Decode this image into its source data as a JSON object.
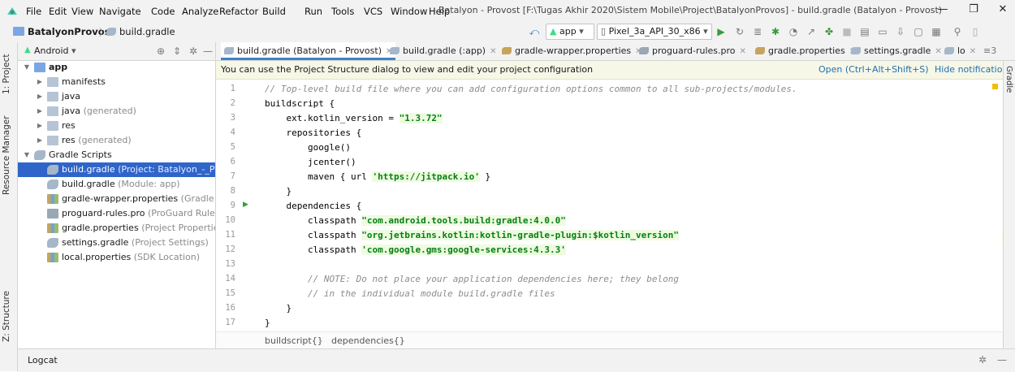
{
  "window": {
    "title": "Batalyon - Provost [F:\\Tugas Akhir 2020\\Sistem Mobile\\Project\\BatalyonProvos] - build.gradle (Batalyon - Provost)",
    "menu": [
      "File",
      "Edit",
      "View",
      "Navigate",
      "Code",
      "Analyze",
      "Refactor",
      "Build",
      "Run",
      "Tools",
      "VCS",
      "Window",
      "Help"
    ],
    "controls": {
      "minimize": "—",
      "maximize": "❐",
      "close": "✕"
    }
  },
  "navbar": {
    "project": "BatalyonProvos",
    "file": "build.gradle",
    "run_config": "app",
    "device": "Pixel_3a_API_30_x86"
  },
  "tool_stripe": {
    "project": "1: Project",
    "resource_manager": "Resource Manager",
    "structure": "Z: Structure"
  },
  "project_panel": {
    "view_mode": "Android",
    "tree": [
      {
        "label": "app",
        "hint": "",
        "level": 0,
        "arrow": "▼",
        "icon": "folder-blue",
        "bold": true
      },
      {
        "label": "manifests",
        "hint": "",
        "level": 1,
        "arrow": "▶",
        "icon": "folder"
      },
      {
        "label": "java",
        "hint": "",
        "level": 1,
        "arrow": "▶",
        "icon": "folder"
      },
      {
        "label": "java",
        "hint": "(generated)",
        "level": 1,
        "arrow": "▶",
        "icon": "folder"
      },
      {
        "label": "res",
        "hint": "",
        "level": 1,
        "arrow": "▶",
        "icon": "folder"
      },
      {
        "label": "res",
        "hint": "(generated)",
        "level": 1,
        "arrow": "▶",
        "icon": "folder"
      },
      {
        "label": "Gradle Scripts",
        "hint": "",
        "level": 0,
        "arrow": "▼",
        "icon": "gradle-ico"
      },
      {
        "label": "build.gradle",
        "hint": "(Project: Batalyon_-_Provo",
        "level": 1,
        "arrow": "",
        "icon": "gradle-ico",
        "selected": true
      },
      {
        "label": "build.gradle",
        "hint": "(Module: app)",
        "level": 1,
        "arrow": "",
        "icon": "gradle-ico"
      },
      {
        "label": "gradle-wrapper.properties",
        "hint": "(Gradle Vers",
        "level": 1,
        "arrow": "",
        "icon": "props-ico"
      },
      {
        "label": "proguard-rules.pro",
        "hint": "(ProGuard Rules fo",
        "level": 1,
        "arrow": "",
        "icon": "doc-ico"
      },
      {
        "label": "gradle.properties",
        "hint": "(Project Properties)",
        "level": 1,
        "arrow": "",
        "icon": "props-ico"
      },
      {
        "label": "settings.gradle",
        "hint": "(Project Settings)",
        "level": 1,
        "arrow": "",
        "icon": "gradle-ico"
      },
      {
        "label": "local.properties",
        "hint": "(SDK Location)",
        "level": 1,
        "arrow": "",
        "icon": "props-ico"
      }
    ]
  },
  "editor_tabs": [
    {
      "label": "build.gradle (Batalyon - Provost)",
      "active": true
    },
    {
      "label": "build.gradle (:app)"
    },
    {
      "label": "gradle-wrapper.properties"
    },
    {
      "label": "proguard-rules.pro"
    },
    {
      "label": "gradle.properties"
    },
    {
      "label": "settings.gradle"
    },
    {
      "label": "lo"
    }
  ],
  "editor_tabs_overflow": "≡3",
  "notification": {
    "message": "You can use the Project Structure dialog to view and edit your project configuration",
    "action": "Open (Ctrl+Alt+Shift+S)",
    "hide": "Hide notification"
  },
  "right_stripe_label": "Gradle",
  "code_lines": [
    {
      "n": "1",
      "text": "// Top-level build file where you can add configuration options common to all sub-projects/modules."
    },
    {
      "n": "2",
      "text": "buildscript {"
    },
    {
      "n": "3",
      "text": "    ext.kotlin_version = \"1.3.72\""
    },
    {
      "n": "4",
      "text": "    repositories {"
    },
    {
      "n": "5",
      "text": "        google()"
    },
    {
      "n": "6",
      "text": "        jcenter()"
    },
    {
      "n": "7",
      "text": "        maven { url 'https://jitpack.io' }"
    },
    {
      "n": "8",
      "text": "    }"
    },
    {
      "n": "9",
      "text": "    dependencies {"
    },
    {
      "n": "10",
      "text": "        classpath \"com.android.tools.build:gradle:4.0.0\""
    },
    {
      "n": "11",
      "text": "        classpath \"org.jetbrains.kotlin:kotlin-gradle-plugin:$kotlin_version\""
    },
    {
      "n": "12",
      "text": "        classpath 'com.google.gms:google-services:4.3.3'"
    },
    {
      "n": "13",
      "text": ""
    },
    {
      "n": "14",
      "text": "        // NOTE: Do not place your application dependencies here; they belong"
    },
    {
      "n": "15",
      "text": "        // in the individual module build.gradle files"
    },
    {
      "n": "16",
      "text": "    }"
    },
    {
      "n": "17",
      "text": "}"
    }
  ],
  "code_breadcrumb": {
    "first": "buildscript{}",
    "sep": "›",
    "second": "dependencies{}"
  },
  "bottom_panel": {
    "title": "Logcat"
  }
}
